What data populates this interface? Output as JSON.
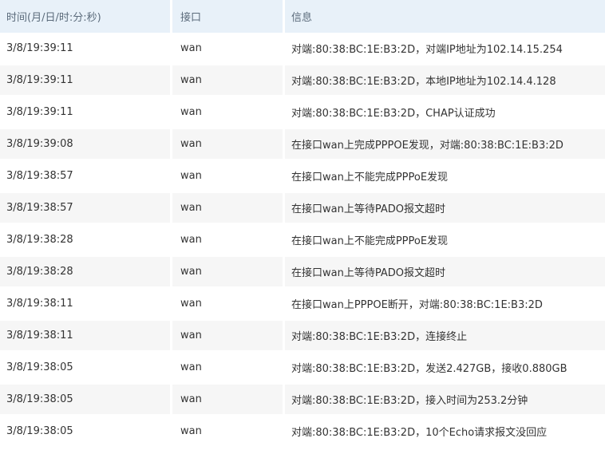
{
  "table": {
    "headers": {
      "time": "时间(月/日/时:分:秒)",
      "interface": "接口",
      "info": "信息"
    },
    "rows": [
      {
        "time": "3/8/19:39:11",
        "interface": "wan",
        "info": "对端:80:38:BC:1E:B3:2D，对端IP地址为102.14.15.254"
      },
      {
        "time": "3/8/19:39:11",
        "interface": "wan",
        "info": "对端:80:38:BC:1E:B3:2D，本地IP地址为102.14.4.128"
      },
      {
        "time": "3/8/19:39:11",
        "interface": "wan",
        "info": "对端:80:38:BC:1E:B3:2D，CHAP认证成功"
      },
      {
        "time": "3/8/19:39:08",
        "interface": "wan",
        "info": "在接口wan上完成PPPOE发现，对端:80:38:BC:1E:B3:2D"
      },
      {
        "time": "3/8/19:38:57",
        "interface": "wan",
        "info": "在接口wan上不能完成PPPoE发现"
      },
      {
        "time": "3/8/19:38:57",
        "interface": "wan",
        "info": "在接口wan上等待PADO报文超时"
      },
      {
        "time": "3/8/19:38:28",
        "interface": "wan",
        "info": "在接口wan上不能完成PPPoE发现"
      },
      {
        "time": "3/8/19:38:28",
        "interface": "wan",
        "info": "在接口wan上等待PADO报文超时"
      },
      {
        "time": "3/8/19:38:11",
        "interface": "wan",
        "info": "在接口wan上PPPOE断开，对端:80:38:BC:1E:B3:2D"
      },
      {
        "time": "3/8/19:38:11",
        "interface": "wan",
        "info": "对端:80:38:BC:1E:B3:2D，连接终止"
      },
      {
        "time": "3/8/19:38:05",
        "interface": "wan",
        "info": "对端:80:38:BC:1E:B3:2D，发送2.427GB，接收0.880GB"
      },
      {
        "time": "3/8/19:38:05",
        "interface": "wan",
        "info": "对端:80:38:BC:1E:B3:2D，接入时间为253.2分钟"
      },
      {
        "time": "3/8/19:38:05",
        "interface": "wan",
        "info": "对端:80:38:BC:1E:B3:2D，10个Echo请求报文没回应"
      }
    ]
  },
  "colors": {
    "header_bg": "#e8f1f9",
    "header_text": "#5b6b7b",
    "row_alt_bg": "#f6f6f6",
    "text": "#333333"
  }
}
